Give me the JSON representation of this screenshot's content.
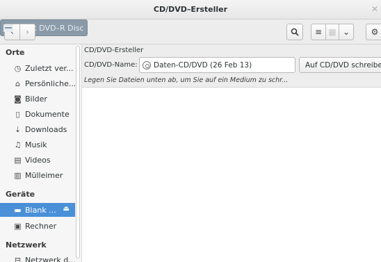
{
  "window": {
    "title": "CD/DVD–Ersteller",
    "close_glyph": "✕"
  },
  "toolbar": {
    "back_glyph": "‹",
    "forward_glyph": "›",
    "path_label": "Blank DVD–R Disc",
    "search_glyph": "🔍",
    "list_glyph": "≡",
    "grid_glyph": "▦",
    "dropdown_glyph": "⌄",
    "gear_glyph": "⚙"
  },
  "sidebar": {
    "places_heading": "Orte",
    "places": [
      {
        "label": "Zuletzt ver...",
        "icon": "clock-icon",
        "glyph": "◷"
      },
      {
        "label": "Persönliche...",
        "icon": "home-icon",
        "glyph": "⌂"
      },
      {
        "label": "Bilder",
        "icon": "camera-icon",
        "glyph": "◙"
      },
      {
        "label": "Dokumente",
        "icon": "document-icon",
        "glyph": "▯"
      },
      {
        "label": "Downloads",
        "icon": "download-icon",
        "glyph": "⇣"
      },
      {
        "label": "Musik",
        "icon": "music-icon",
        "glyph": "♫"
      },
      {
        "label": "Videos",
        "icon": "film-icon",
        "glyph": "▤"
      },
      {
        "label": "Mülleimer",
        "icon": "trash-icon",
        "glyph": "▥"
      }
    ],
    "devices_heading": "Geräte",
    "devices": [
      {
        "label": "Blank ...",
        "icon": "disc-drive-icon",
        "glyph": "▬",
        "eject_glyph": "⏏"
      },
      {
        "label": "Rechner",
        "icon": "computer-icon",
        "glyph": "▣"
      }
    ],
    "network_heading": "Netzwerk",
    "network": [
      {
        "label": "Netzwerk d...",
        "icon": "network-icon",
        "glyph": "⊟"
      }
    ]
  },
  "burner": {
    "title": "CD/DVD-Ersteller",
    "name_label": "CD/DVD-Name:",
    "name_value": "Daten-CD/DVD (26 Feb 13)",
    "burn_button": "Auf CD/DVD schreiben",
    "hint": "Legen Sie Dateien unten ab, um Sie auf ein Medium zu schr..."
  },
  "colors": {
    "selection": "#4a90d9",
    "path_button": "#8a9aa8"
  }
}
